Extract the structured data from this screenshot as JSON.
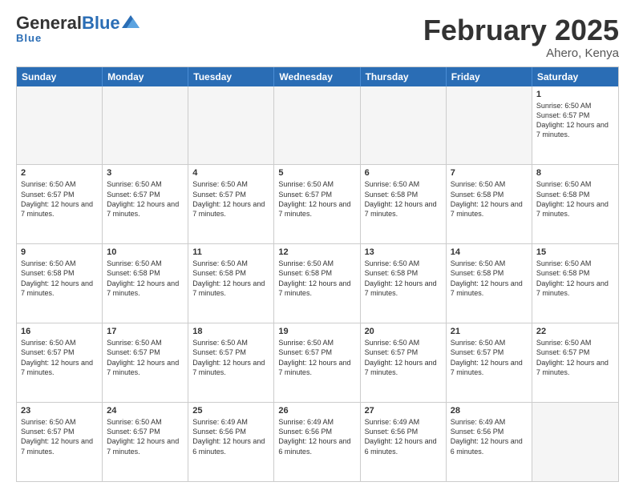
{
  "header": {
    "logo_general": "General",
    "logo_blue": "Blue",
    "month_title": "February 2025",
    "location": "Ahero, Kenya"
  },
  "calendar": {
    "days": [
      "Sunday",
      "Monday",
      "Tuesday",
      "Wednesday",
      "Thursday",
      "Friday",
      "Saturday"
    ],
    "rows": [
      [
        {
          "day": "",
          "empty": true
        },
        {
          "day": "",
          "empty": true
        },
        {
          "day": "",
          "empty": true
        },
        {
          "day": "",
          "empty": true
        },
        {
          "day": "",
          "empty": true
        },
        {
          "day": "",
          "empty": true
        },
        {
          "day": "1",
          "text": "Sunrise: 6:50 AM\nSunset: 6:57 PM\nDaylight: 12 hours\nand 7 minutes."
        }
      ],
      [
        {
          "day": "2",
          "text": "Sunrise: 6:50 AM\nSunset: 6:57 PM\nDaylight: 12 hours\nand 7 minutes."
        },
        {
          "day": "3",
          "text": "Sunrise: 6:50 AM\nSunset: 6:57 PM\nDaylight: 12 hours\nand 7 minutes."
        },
        {
          "day": "4",
          "text": "Sunrise: 6:50 AM\nSunset: 6:57 PM\nDaylight: 12 hours\nand 7 minutes."
        },
        {
          "day": "5",
          "text": "Sunrise: 6:50 AM\nSunset: 6:57 PM\nDaylight: 12 hours\nand 7 minutes."
        },
        {
          "day": "6",
          "text": "Sunrise: 6:50 AM\nSunset: 6:58 PM\nDaylight: 12 hours\nand 7 minutes."
        },
        {
          "day": "7",
          "text": "Sunrise: 6:50 AM\nSunset: 6:58 PM\nDaylight: 12 hours\nand 7 minutes."
        },
        {
          "day": "8",
          "text": "Sunrise: 6:50 AM\nSunset: 6:58 PM\nDaylight: 12 hours\nand 7 minutes."
        }
      ],
      [
        {
          "day": "9",
          "text": "Sunrise: 6:50 AM\nSunset: 6:58 PM\nDaylight: 12 hours\nand 7 minutes."
        },
        {
          "day": "10",
          "text": "Sunrise: 6:50 AM\nSunset: 6:58 PM\nDaylight: 12 hours\nand 7 minutes."
        },
        {
          "day": "11",
          "text": "Sunrise: 6:50 AM\nSunset: 6:58 PM\nDaylight: 12 hours\nand 7 minutes."
        },
        {
          "day": "12",
          "text": "Sunrise: 6:50 AM\nSunset: 6:58 PM\nDaylight: 12 hours\nand 7 minutes."
        },
        {
          "day": "13",
          "text": "Sunrise: 6:50 AM\nSunset: 6:58 PM\nDaylight: 12 hours\nand 7 minutes."
        },
        {
          "day": "14",
          "text": "Sunrise: 6:50 AM\nSunset: 6:58 PM\nDaylight: 12 hours\nand 7 minutes."
        },
        {
          "day": "15",
          "text": "Sunrise: 6:50 AM\nSunset: 6:58 PM\nDaylight: 12 hours\nand 7 minutes."
        }
      ],
      [
        {
          "day": "16",
          "text": "Sunrise: 6:50 AM\nSunset: 6:57 PM\nDaylight: 12 hours\nand 7 minutes."
        },
        {
          "day": "17",
          "text": "Sunrise: 6:50 AM\nSunset: 6:57 PM\nDaylight: 12 hours\nand 7 minutes."
        },
        {
          "day": "18",
          "text": "Sunrise: 6:50 AM\nSunset: 6:57 PM\nDaylight: 12 hours\nand 7 minutes."
        },
        {
          "day": "19",
          "text": "Sunrise: 6:50 AM\nSunset: 6:57 PM\nDaylight: 12 hours\nand 7 minutes."
        },
        {
          "day": "20",
          "text": "Sunrise: 6:50 AM\nSunset: 6:57 PM\nDaylight: 12 hours\nand 7 minutes."
        },
        {
          "day": "21",
          "text": "Sunrise: 6:50 AM\nSunset: 6:57 PM\nDaylight: 12 hours\nand 7 minutes."
        },
        {
          "day": "22",
          "text": "Sunrise: 6:50 AM\nSunset: 6:57 PM\nDaylight: 12 hours\nand 7 minutes."
        }
      ],
      [
        {
          "day": "23",
          "text": "Sunrise: 6:50 AM\nSunset: 6:57 PM\nDaylight: 12 hours\nand 7 minutes."
        },
        {
          "day": "24",
          "text": "Sunrise: 6:50 AM\nSunset: 6:57 PM\nDaylight: 12 hours\nand 7 minutes."
        },
        {
          "day": "25",
          "text": "Sunrise: 6:49 AM\nSunset: 6:56 PM\nDaylight: 12 hours\nand 6 minutes."
        },
        {
          "day": "26",
          "text": "Sunrise: 6:49 AM\nSunset: 6:56 PM\nDaylight: 12 hours\nand 6 minutes."
        },
        {
          "day": "27",
          "text": "Sunrise: 6:49 AM\nSunset: 6:56 PM\nDaylight: 12 hours\nand 6 minutes."
        },
        {
          "day": "28",
          "text": "Sunrise: 6:49 AM\nSunset: 6:56 PM\nDaylight: 12 hours\nand 6 minutes."
        },
        {
          "day": "",
          "empty": true
        }
      ]
    ]
  }
}
